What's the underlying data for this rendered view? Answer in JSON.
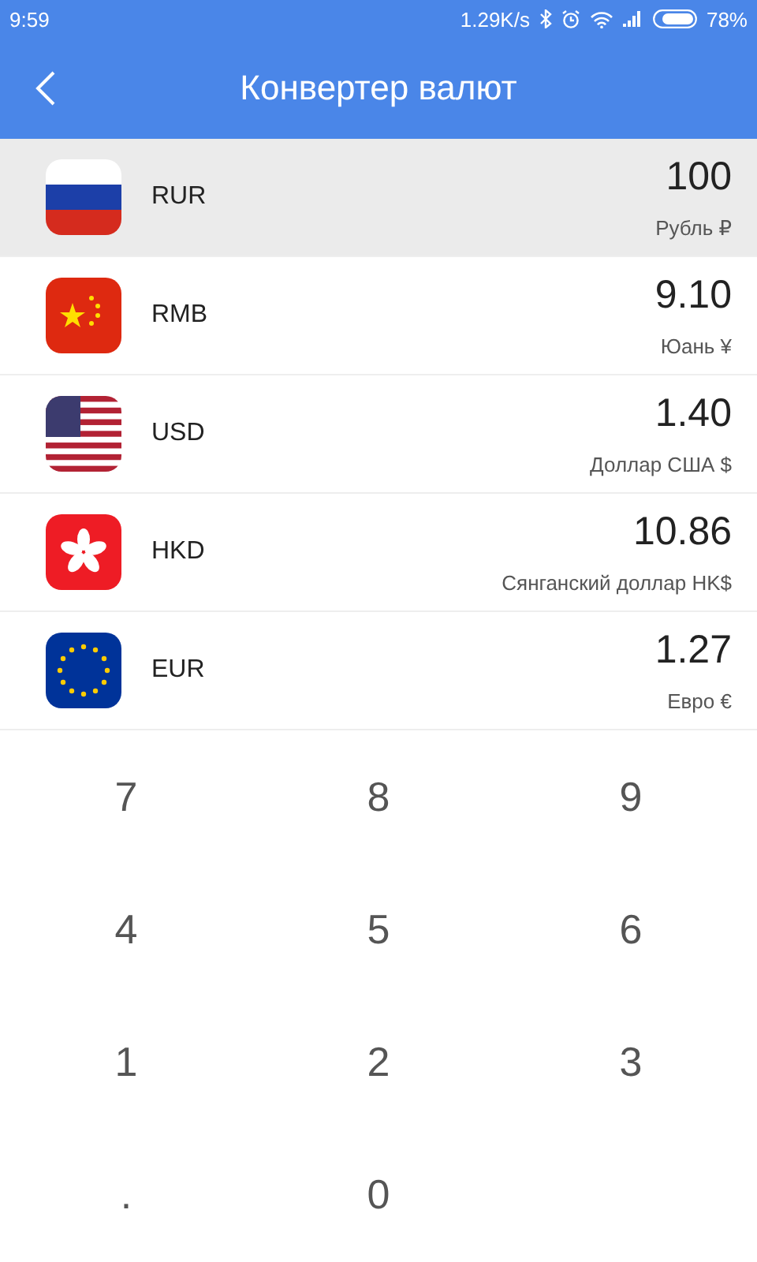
{
  "status_bar": {
    "time": "9:59",
    "speed": "1.29K/s",
    "battery": "78%"
  },
  "header": {
    "title": "Конвертер валют"
  },
  "currencies": [
    {
      "code": "RUR",
      "amount": "100",
      "name": "Рубль ₽",
      "kind": "ru",
      "selected": true
    },
    {
      "code": "RMB",
      "amount": "9.10",
      "name": "Юань ¥",
      "kind": "cn",
      "selected": false
    },
    {
      "code": "USD",
      "amount": "1.40",
      "name": "Доллар США $",
      "kind": "us",
      "selected": false
    },
    {
      "code": "HKD",
      "amount": "10.86",
      "name": "Сянганский доллар HK$",
      "kind": "hk",
      "selected": false
    },
    {
      "code": "EUR",
      "amount": "1.27",
      "name": "Евро €",
      "kind": "eu",
      "selected": false
    }
  ],
  "keypad": [
    "7",
    "8",
    "9",
    "4",
    "5",
    "6",
    "1",
    "2",
    "3",
    ".",
    "0"
  ]
}
